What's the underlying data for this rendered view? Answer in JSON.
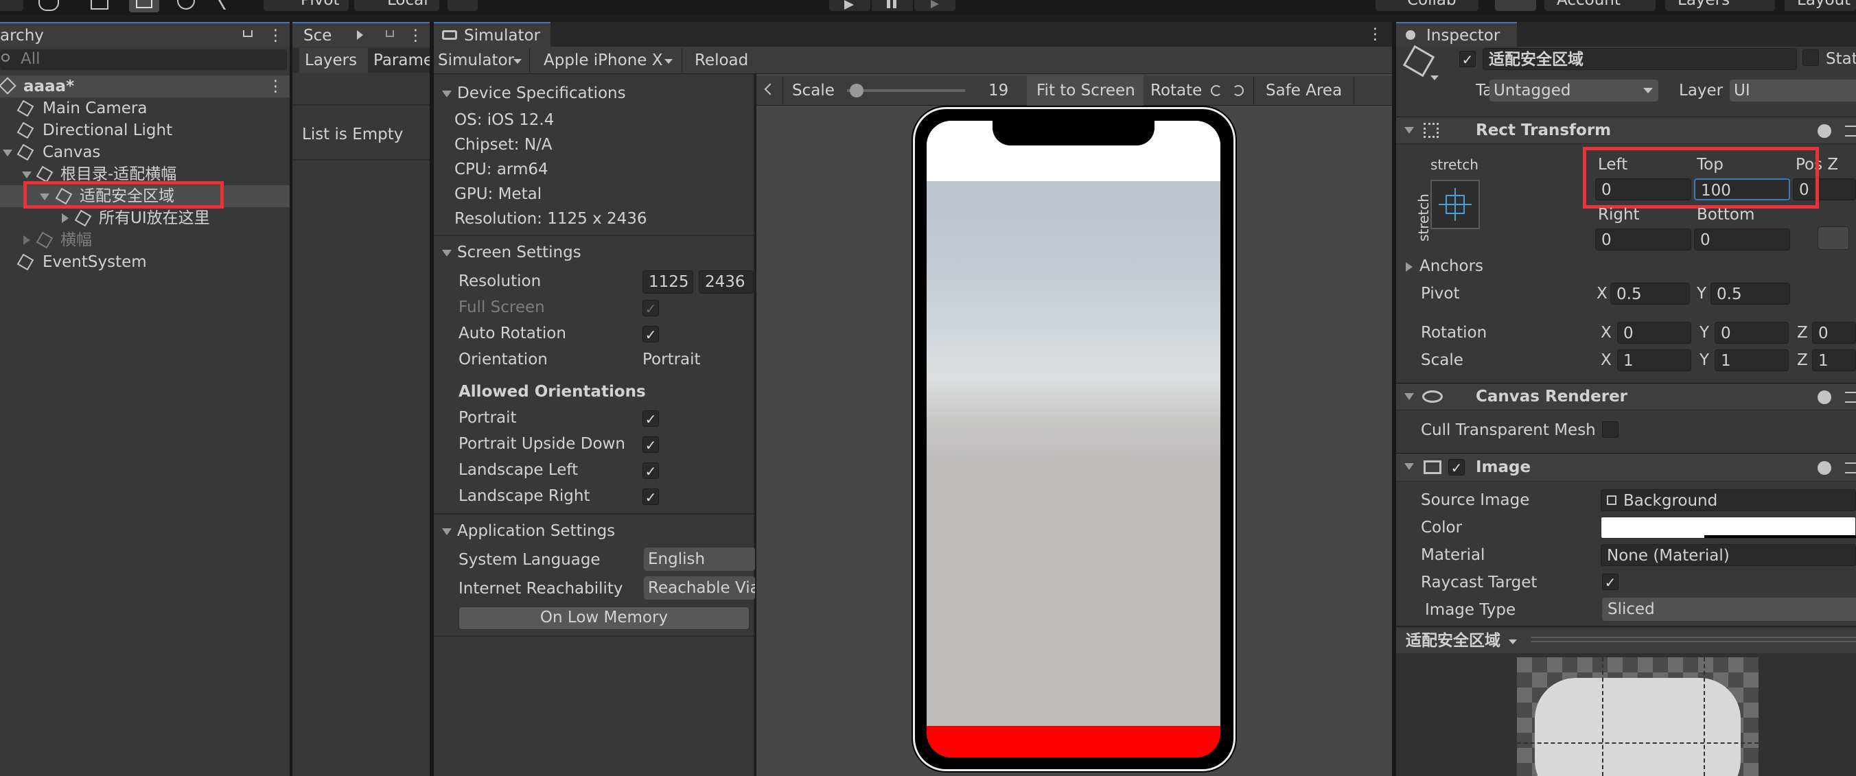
{
  "toolbar": {
    "pivot": "Pivot",
    "local": "Local",
    "collab": "Collab",
    "account": "Account",
    "layers": "Layers",
    "layout": "Layout"
  },
  "hierarchy": {
    "tab_label": "archy",
    "search_placeholder": "All",
    "scene": "aaaa*",
    "items": [
      "Main Camera",
      "Directional Light",
      "Canvas",
      "根目录-适配横幅",
      "适配安全区域",
      "所有UI放在这里",
      "横幅",
      "EventSystem"
    ]
  },
  "scene_panel": {
    "tab_label": "Sce",
    "tab_layers": "Layers",
    "tab_params": "Parame",
    "empty_text": "List is Empty"
  },
  "simulator": {
    "tab_label": "Simulator",
    "dropdown": "Simulator",
    "device": "Apple iPhone X",
    "reload": "Reload",
    "scale_label": "Scale",
    "scale_value": "19",
    "scale_fraction": 0.08,
    "fit_to_screen": "Fit to Screen",
    "rotate": "Rotate",
    "safe_area": "Safe Area",
    "device_specs": {
      "title": "Device Specifications",
      "lines": [
        "OS: iOS 12.4",
        "Chipset: N/A",
        "CPU: arm64",
        "GPU: Metal",
        "Resolution: 1125 x 2436"
      ]
    },
    "screen_settings": {
      "title": "Screen Settings",
      "resolution_label": "Resolution",
      "res_w": "1125",
      "res_h": "2436",
      "full_screen": "Full Screen",
      "auto_rotation": "Auto Rotation",
      "orientation_label": "Orientation",
      "orientation_value": "Portrait",
      "allowed_title": "Allowed Orientations",
      "allowed": [
        "Portrait",
        "Portrait Upside Down",
        "Landscape Left",
        "Landscape Right"
      ]
    },
    "app_settings": {
      "title": "Application Settings",
      "system_language_label": "System Language",
      "system_language_value": "English",
      "internet_label": "Internet Reachability",
      "internet_value": "Reachable Via",
      "low_memory": "On Low Memory"
    },
    "colors": {
      "safe_area_bottom": "#ff0000",
      "background": "#bdbcbb"
    }
  },
  "inspector": {
    "tab_label": "Inspector",
    "object_name": "适配安全区域",
    "static_label": "Stat",
    "tag_label": "Tag",
    "tag_value": "Untagged",
    "layer_label": "Layer",
    "layer_value": "UI",
    "rect_transform": {
      "title": "Rect Transform",
      "anchor_preset_h": "stretch",
      "anchor_preset_v": "stretch",
      "left_label": "Left",
      "left_value": "0",
      "top_label": "Top",
      "top_value": "100",
      "posz_label": "Pos Z",
      "posz_value": "0",
      "right_label": "Right",
      "right_value": "0",
      "bottom_label": "Bottom",
      "bottom_value": "0",
      "anchors": "Anchors",
      "pivot_label": "Pivot",
      "pivot_x": "0.5",
      "pivot_y": "0.5",
      "rotation_label": "Rotation",
      "rot_x": "0",
      "rot_y": "0",
      "rot_z": "0",
      "scale_label": "Scale",
      "scale_x": "1",
      "scale_y": "1",
      "scale_z": "1",
      "x": "X",
      "y": "Y",
      "z": "Z"
    },
    "canvas_renderer": {
      "title": "Canvas Renderer",
      "cull_label": "Cull Transparent Mesh"
    },
    "image": {
      "title": "Image",
      "source_label": "Source Image",
      "source_value": "Background",
      "color_label": "Color",
      "material_label": "Material",
      "material_value": "None (Material)",
      "raycast_label": "Raycast Target",
      "image_type_label": "Image Type",
      "image_type_value": "Sliced"
    },
    "preview_label": "适配安全区域"
  }
}
